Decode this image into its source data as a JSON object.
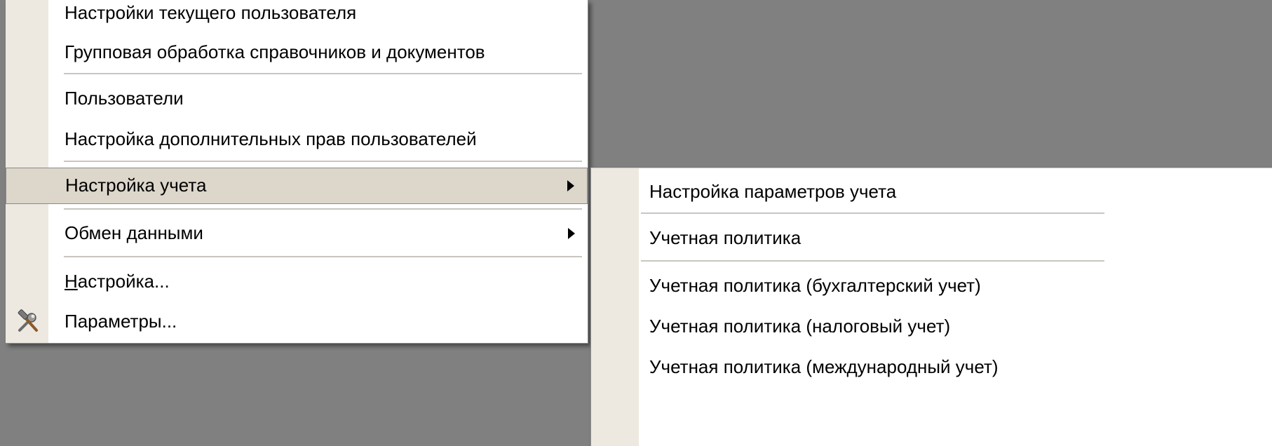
{
  "main_menu": {
    "items": [
      {
        "label": "Настройки текущего пользователя"
      },
      {
        "label": "Групповая обработка справочников и документов"
      },
      {
        "label": "Пользователи"
      },
      {
        "label": "Настройка дополнительных прав пользователей"
      },
      {
        "label": "Настройка учета",
        "has_submenu": true,
        "highlighted": true
      },
      {
        "label": "Обмен данными",
        "has_submenu": true
      },
      {
        "label_mnemonic": "Н",
        "label_rest": "астройка..."
      },
      {
        "label": "Параметры...",
        "icon": "tools-icon"
      }
    ]
  },
  "submenu": {
    "items": [
      {
        "label": "Настройка параметров учета"
      },
      {
        "label": "Учетная политика"
      },
      {
        "label": "Учетная политика (бухгалтерский учет)"
      },
      {
        "label": "Учетная политика (налоговый учет)"
      },
      {
        "label": "Учетная политика (международный учет)"
      }
    ]
  },
  "colors": {
    "desktop_background": "#808080",
    "menu_background": "#ffffff",
    "gutter": "#ede9e1",
    "highlight": "#dcd6cb",
    "separator": "#c9c6bf"
  }
}
